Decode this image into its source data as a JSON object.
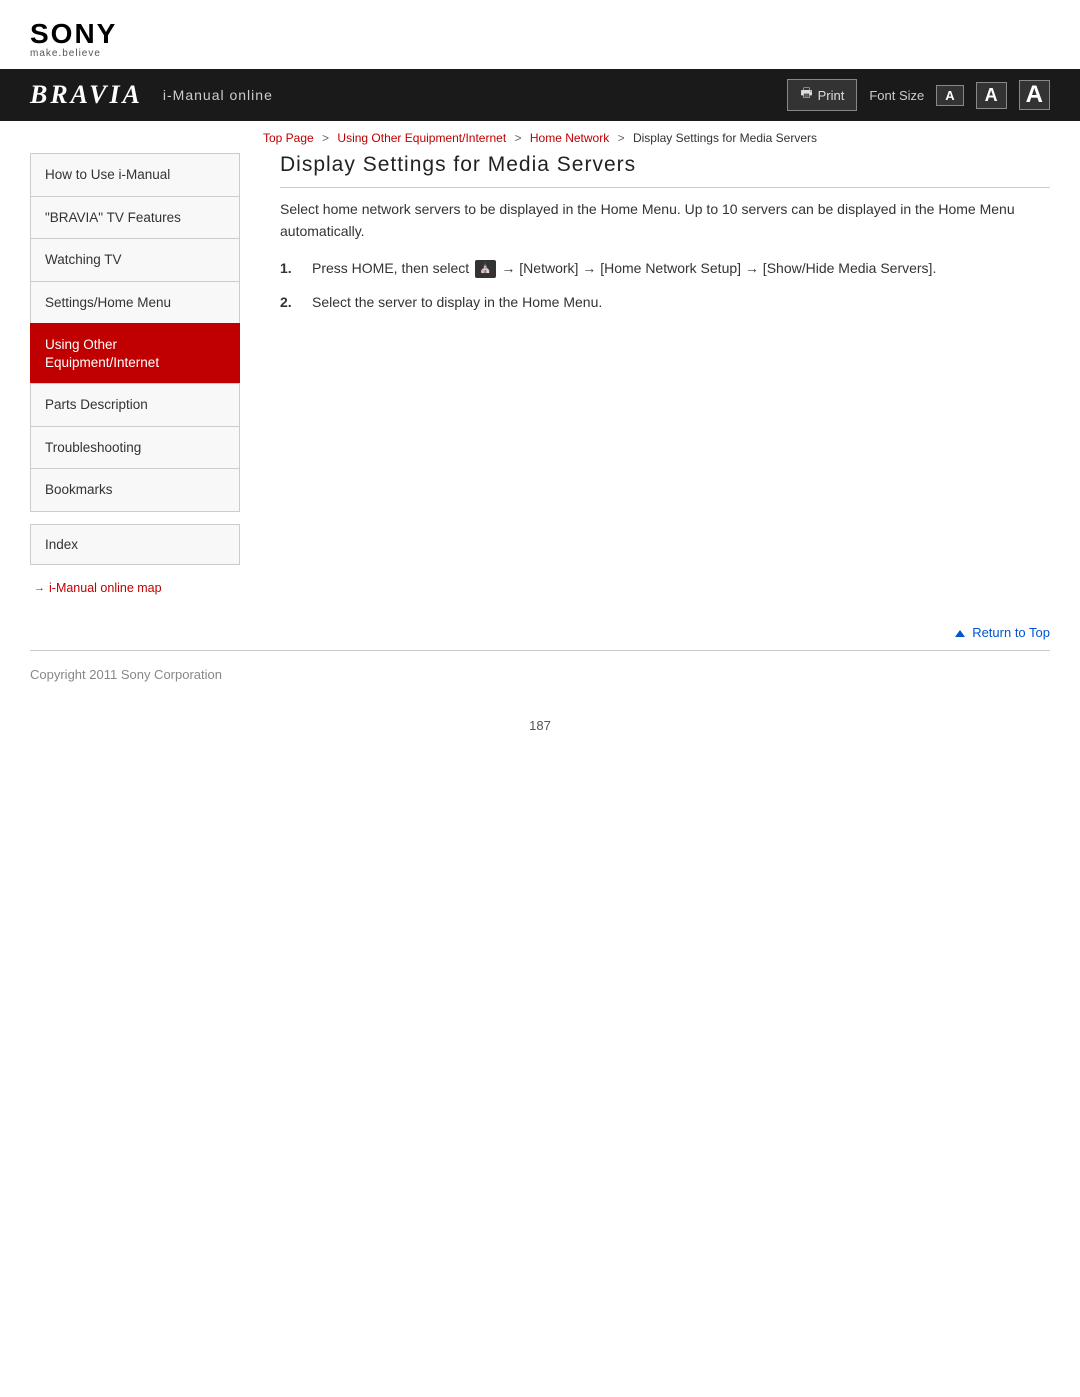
{
  "header": {
    "sony_logo": "SONY",
    "sony_tagline": "make.believe",
    "bravia_logo": "BRAVIA",
    "bravia_subtitle": "i-Manual online",
    "print_label": "Print",
    "font_size_label": "Font Size",
    "font_small": "A",
    "font_medium": "A",
    "font_large": "A"
  },
  "breadcrumb": {
    "top_page": "Top Page",
    "sep1": ">",
    "link1": "Using Other Equipment/Internet",
    "sep2": ">",
    "link2": "Home Network",
    "sep3": ">",
    "current": "Display Settings for Media Servers"
  },
  "sidebar": {
    "items": [
      {
        "label": "How to Use i-Manual",
        "active": false
      },
      {
        "label": "\"BRAVIA\" TV Features",
        "active": false
      },
      {
        "label": "Watching TV",
        "active": false
      },
      {
        "label": "Settings/Home Menu",
        "active": false
      },
      {
        "label": "Using Other Equipment/Internet",
        "active": true
      },
      {
        "label": "Parts Description",
        "active": false
      },
      {
        "label": "Troubleshooting",
        "active": false
      },
      {
        "label": "Bookmarks",
        "active": false
      }
    ],
    "index_label": "Index",
    "map_link": "i-Manual online map"
  },
  "content": {
    "page_title": "Display Settings for Media Servers",
    "intro": "Select home network servers to be displayed in the Home Menu. Up to 10 servers can be displayed in the Home Menu automatically.",
    "steps": [
      {
        "num": "1.",
        "text": "Press HOME, then select ⌂ → [Network] → [Home Network Setup] → [Show/Hide Media Servers]."
      },
      {
        "num": "2.",
        "text": "Select the server to display in the Home Menu."
      }
    ]
  },
  "return_top": {
    "label": "Return to Top"
  },
  "footer": {
    "copyright": "Copyright 2011 Sony Corporation"
  },
  "page_number": "187"
}
